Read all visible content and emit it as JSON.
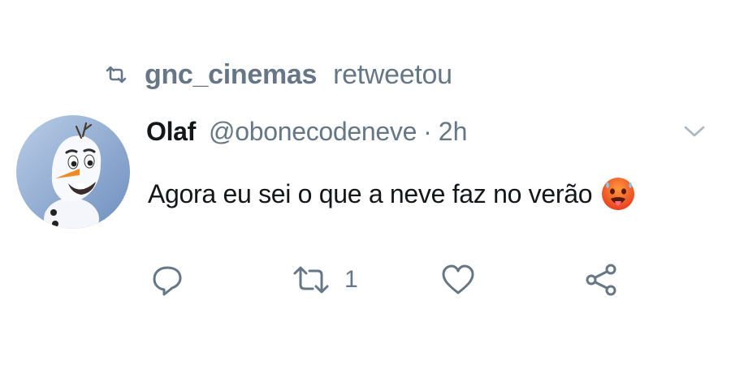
{
  "retweet_bar": {
    "icon": "retweet-icon",
    "user": "gnc_cinemas",
    "label": "retweetou"
  },
  "tweet": {
    "author": {
      "name": "Olaf",
      "handle": "@obonecodeneve",
      "avatar": "olaf-avatar"
    },
    "separator": "·",
    "time": "2h",
    "text": "Agora eu sei o que a neve faz no verão",
    "emoji": "hot-face-emoji",
    "menu_icon": "chevron-down-icon"
  },
  "actions": {
    "reply": {
      "icon": "reply-icon"
    },
    "retweet": {
      "icon": "retweet-icon",
      "count": "1"
    },
    "like": {
      "icon": "heart-icon"
    },
    "share": {
      "icon": "share-icon"
    }
  },
  "colors": {
    "text": "#14171a",
    "secondary": "#657786",
    "background": "#ffffff"
  }
}
